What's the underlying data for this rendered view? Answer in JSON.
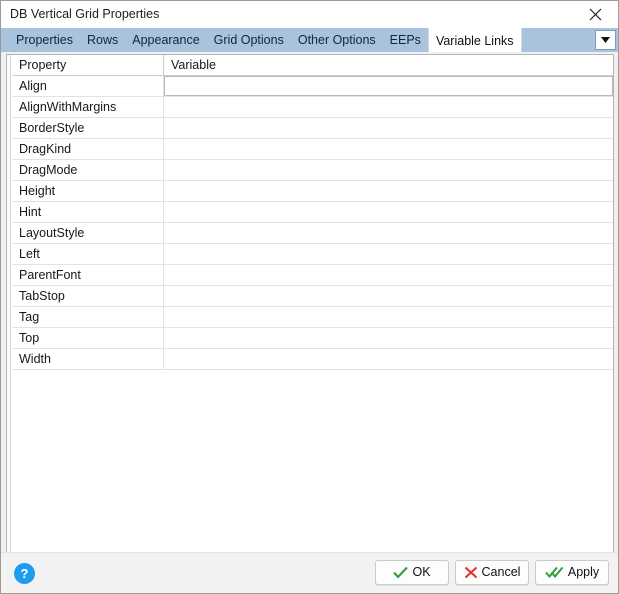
{
  "window": {
    "title": "DB Vertical Grid Properties",
    "close_icon": "close-icon"
  },
  "tabs": [
    {
      "label": "Properties",
      "active": false
    },
    {
      "label": "Rows",
      "active": false
    },
    {
      "label": "Appearance",
      "active": false
    },
    {
      "label": "Grid Options",
      "active": false
    },
    {
      "label": "Other Options",
      "active": false
    },
    {
      "label": "EEPs",
      "active": false
    },
    {
      "label": "Variable Links",
      "active": true
    }
  ],
  "tab_overflow_icon": "chevron-down-icon",
  "grid": {
    "columns": [
      "Property",
      "Variable"
    ],
    "rows": [
      {
        "property": "Align",
        "variable": "",
        "selected": true
      },
      {
        "property": "AlignWithMargins",
        "variable": "",
        "selected": false
      },
      {
        "property": "BorderStyle",
        "variable": "",
        "selected": false
      },
      {
        "property": "DragKind",
        "variable": "",
        "selected": false
      },
      {
        "property": "DragMode",
        "variable": "",
        "selected": false
      },
      {
        "property": "Height",
        "variable": "",
        "selected": false
      },
      {
        "property": "Hint",
        "variable": "",
        "selected": false
      },
      {
        "property": "LayoutStyle",
        "variable": "",
        "selected": false
      },
      {
        "property": "Left",
        "variable": "",
        "selected": false
      },
      {
        "property": "ParentFont",
        "variable": "",
        "selected": false
      },
      {
        "property": "TabStop",
        "variable": "",
        "selected": false
      },
      {
        "property": "Tag",
        "variable": "",
        "selected": false
      },
      {
        "property": "Top",
        "variable": "",
        "selected": false
      },
      {
        "property": "Width",
        "variable": "",
        "selected": false
      }
    ]
  },
  "footer": {
    "help_label": "?",
    "buttons": [
      {
        "label": "OK",
        "icon": "check-icon"
      },
      {
        "label": "Cancel",
        "icon": "cross-icon"
      },
      {
        "label": "Apply",
        "icon": "double-check-icon"
      }
    ]
  },
  "colors": {
    "tabstrip": "#a9c2dd",
    "accent_help": "#1f9cf0",
    "ok_green": "#2e9e3e",
    "cancel_red": "#e03232"
  }
}
